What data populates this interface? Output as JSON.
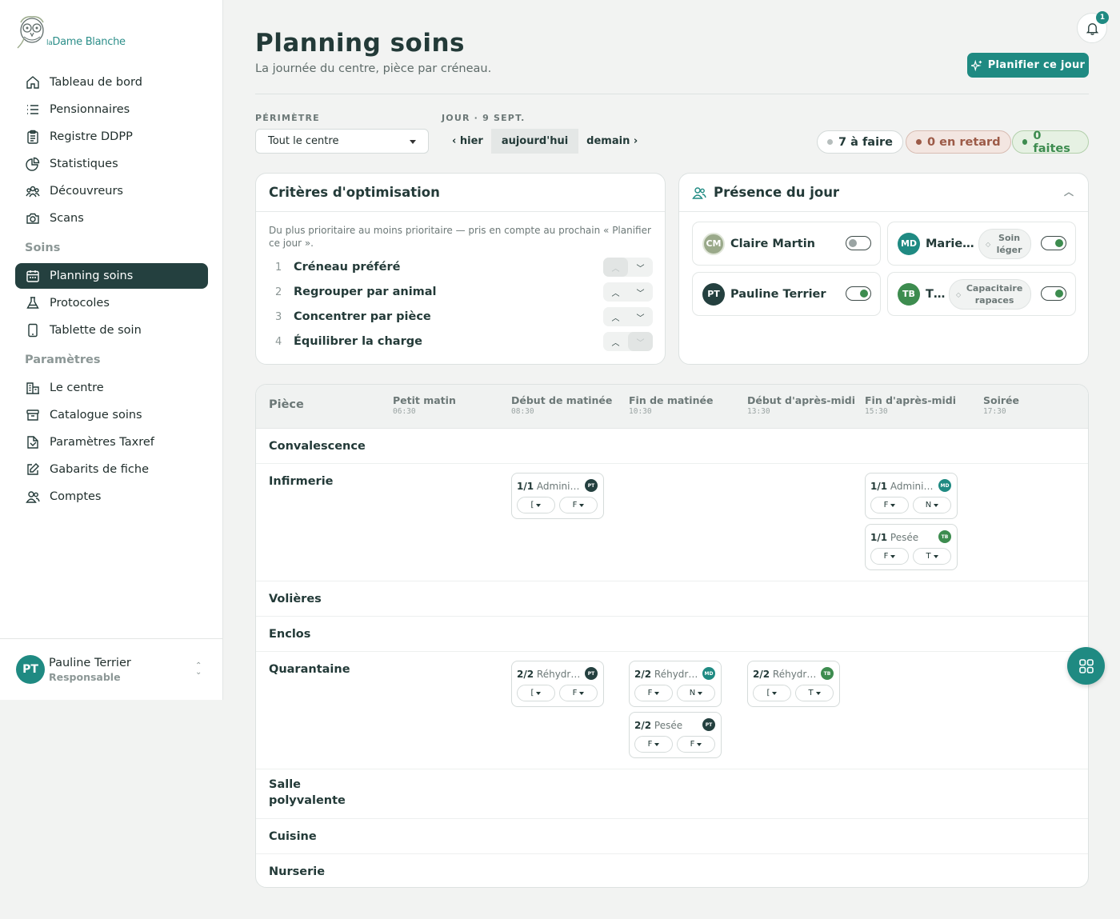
{
  "brand": {
    "logo_prefix": "la",
    "logo_name": "Dame Blanche"
  },
  "sidebar": {
    "items": [
      {
        "label": "Tableau de bord",
        "icon": "home-icon"
      },
      {
        "label": "Pensionnaires",
        "icon": "list-icon"
      },
      {
        "label": "Registre DDPP",
        "icon": "clipboard-icon"
      },
      {
        "label": "Statistiques",
        "icon": "pie-chart-icon"
      },
      {
        "label": "Découvreurs",
        "icon": "users-group-icon"
      },
      {
        "label": "Scans",
        "icon": "camera-icon"
      }
    ],
    "section_soins": "Soins",
    "soins_items": [
      {
        "label": "Planning soins",
        "icon": "calendar-icon",
        "active": true
      },
      {
        "label": "Protocoles",
        "icon": "flask-icon"
      },
      {
        "label": "Tablette de soin",
        "icon": "tablet-icon"
      }
    ],
    "section_params": "Paramètres",
    "params_items": [
      {
        "label": "Le centre",
        "icon": "building-icon"
      },
      {
        "label": "Catalogue soins",
        "icon": "box-icon"
      },
      {
        "label": "Paramètres Taxref",
        "icon": "book-icon"
      },
      {
        "label": "Gabarits de fiche",
        "icon": "edit-icon"
      },
      {
        "label": "Comptes",
        "icon": "users-icon"
      }
    ]
  },
  "user": {
    "initials": "PT",
    "name": "Pauline Terrier",
    "role": "Responsable"
  },
  "notifications": {
    "count": "1"
  },
  "header": {
    "title": "Planning soins",
    "subtitle": "La journée du centre, pièce par créneau.",
    "plan_button": "Planifier ce jour"
  },
  "filters": {
    "perimetre_label": "PÉRIMÈTRE",
    "perimetre_value": "Tout le centre",
    "jour_label": "JOUR · 9 SEPT.",
    "prev": "‹ hier",
    "today": "aujourd'hui",
    "next": "demain ›"
  },
  "counters": {
    "todo": "7 à faire",
    "late": "0 en retard",
    "done": "0 faites"
  },
  "colors": {
    "accent": "#1f8a82",
    "dark": "#24403f",
    "green": "#3d8c4f"
  },
  "criteria": {
    "title": "Critères d'optimisation",
    "description": "Du plus prioritaire au moins prioritaire — pris en compte au prochain « Planifier ce jour ».",
    "items": [
      {
        "num": "1",
        "label": "Créneau préféré"
      },
      {
        "num": "2",
        "label": "Regrouper par animal"
      },
      {
        "num": "3",
        "label": "Concentrer par pièce"
      },
      {
        "num": "4",
        "label": "Équilibrer la charge"
      }
    ]
  },
  "presence": {
    "title": "Présence du jour",
    "people": [
      {
        "initials": "CM",
        "name": "Claire Martin",
        "tag": "",
        "on": false,
        "color": "#9aa98a"
      },
      {
        "initials": "MD",
        "name": "Marie…",
        "tag": "Soin léger",
        "on": true,
        "color": "#1f8a82"
      },
      {
        "initials": "PT",
        "name": "Pauline Terrier",
        "tag": "",
        "on": true,
        "color": "#24403f"
      },
      {
        "initials": "TB",
        "name": "T…",
        "tag": "Capacitaire rapaces",
        "on": true,
        "color": "#3d8c4f"
      }
    ]
  },
  "planning": {
    "room_header": "Pièce",
    "slots": [
      {
        "name": "Petit matin",
        "time": "06:30"
      },
      {
        "name": "Début de matinée",
        "time": "08:30"
      },
      {
        "name": "Fin de matinée",
        "time": "10:30"
      },
      {
        "name": "Début d'après-midi",
        "time": "13:30"
      },
      {
        "name": "Fin d'après-midi",
        "time": "15:30"
      },
      {
        "name": "Soirée",
        "time": "17:30"
      }
    ],
    "rooms": [
      "Convalescence",
      "Infirmerie",
      "Volières",
      "Enclos",
      "Quarantaine",
      "Salle polyvalente",
      "Cuisine",
      "Nurserie"
    ],
    "tasks": [
      {
        "count": "1/1",
        "name": "Admini…",
        "avatar": "PT",
        "d1": "[",
        "d2": "F"
      },
      {
        "count": "1/1",
        "name": "Admini…",
        "avatar": "MD",
        "d1": "F",
        "d2": "N"
      },
      {
        "count": "1/1",
        "name": "Pesée",
        "avatar": "TB",
        "d1": "F",
        "d2": "T"
      },
      {
        "count": "2/2",
        "name": "Réhydr…",
        "avatar": "PT",
        "d1": "[",
        "d2": "F"
      },
      {
        "count": "2/2",
        "name": "Réhydr…",
        "avatar": "MD",
        "d1": "F",
        "d2": "N"
      },
      {
        "count": "2/2",
        "name": "Pesée",
        "avatar": "PT",
        "d1": "F",
        "d2": "F"
      },
      {
        "count": "2/2",
        "name": "Réhydr…",
        "avatar": "TB",
        "d1": "[",
        "d2": "T"
      }
    ]
  }
}
